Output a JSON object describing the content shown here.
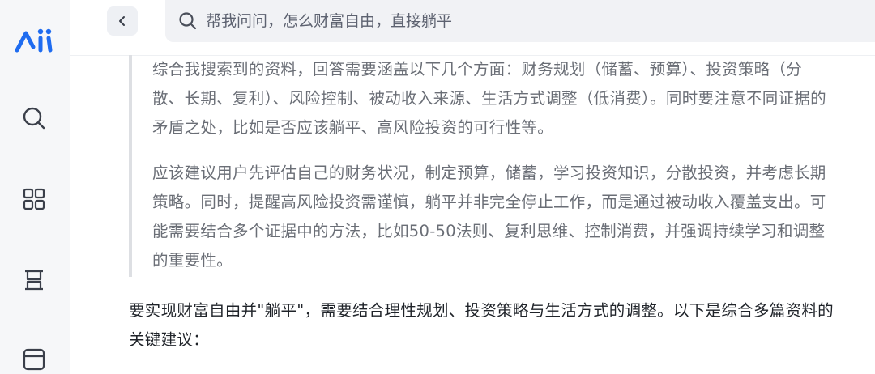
{
  "sidebar": {
    "brand_color": "#1f6cf0",
    "icons": [
      "logo",
      "search-icon",
      "grid-icon",
      "layers-icon",
      "window-icon"
    ]
  },
  "search": {
    "placeholder": "帮我问问，怎么财富自由，直接躺平"
  },
  "thinking": {
    "paragraph1": "综合我搜索到的资料，回答需要涵盖以下几个方面：财务规划（储蓄、预算）、投资策略（分散、长期、复利）、风险控制、被动收入来源、生活方式调整（低消费）。同时要注意不同证据的矛盾之处，比如是否应该躺平、高风险投资的可行性等。",
    "paragraph2": "应该建议用户先评估自己的财务状况，制定预算，储蓄，学习投资知识，分散投资，并考虑长期策略。同时，提醒高风险投资需谨慎，躺平并非完全停止工作，而是通过被动收入覆盖支出。可能需要结合多个证据中的方法，比如50-50法则、复利思维、控制消费，并强调持续学习和调整的重要性。"
  },
  "answer": {
    "text": "要实现财富自由并\"躺平\"，需要结合理性规划、投资策略与生活方式的调整。以下是综合多篇资料的关键建议："
  }
}
